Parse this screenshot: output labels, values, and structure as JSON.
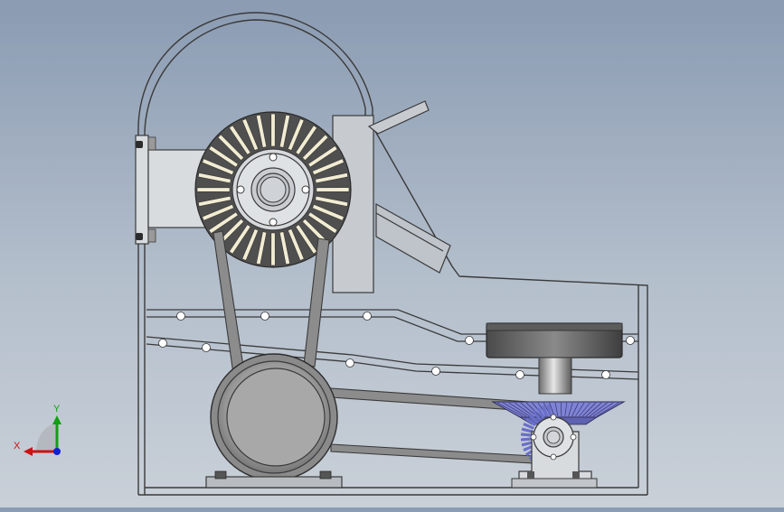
{
  "scene": {
    "triad": {
      "x_label": "X",
      "y_label": "Y",
      "x_color": "#d01010",
      "y_color": "#10a010",
      "z_color": "#1020d0"
    },
    "colors": {
      "outline": "#3a3a3a",
      "housing_fill": "#cfd3d8",
      "metal": "#b9bcc0",
      "dark_metal": "#5a5a5a",
      "gear_blue": "#7f83d6",
      "blade_light": "#f1ecd2"
    },
    "parts": [
      "hopper-hood",
      "rotor-bearing-housing",
      "slotted-rotor",
      "rotor-shaft",
      "feed-chute",
      "screen-plate",
      "v-belt",
      "motor-pulley",
      "motor-base",
      "bevel-gear",
      "turntable",
      "gear-bearing-block",
      "side-frame"
    ]
  }
}
